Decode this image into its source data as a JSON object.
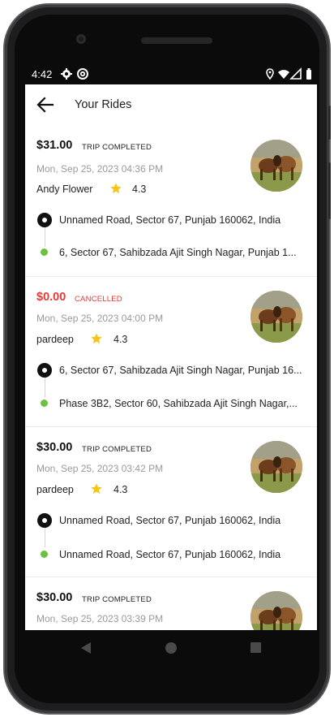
{
  "status_bar": {
    "time": "4:42",
    "left_icons": [
      "gear-icon",
      "at-icon"
    ],
    "right_icons": [
      "location-icon",
      "wifi-icon",
      "signal-icon",
      "battery-icon"
    ]
  },
  "app_bar": {
    "back_icon": "arrow-left-icon",
    "title": "Your Rides"
  },
  "colors": {
    "accent_cancel": "#e53935",
    "drop_dot": "#6ec043",
    "star": "#f5c518"
  },
  "rides": [
    {
      "fare": "$31.00",
      "status": "TRIP COMPLETED",
      "cancelled": false,
      "date": "Mon, Sep 25, 2023 04:36 PM",
      "driver": "Andy Flower",
      "rating": "4.3",
      "pickup": "Unnamed Road, Sector 67, Punjab 160062, India",
      "drop": "6, Sector 67, Sahibzada Ajit Singh Nagar, Punjab 1..."
    },
    {
      "fare": "$0.00",
      "status": "CANCELLED",
      "cancelled": true,
      "date": "Mon, Sep 25, 2023 04:00 PM",
      "driver": "pardeep",
      "rating": "4.3",
      "pickup": "6, Sector 67, Sahibzada Ajit Singh Nagar, Punjab 16...",
      "drop": "Phase 3B2, Sector 60, Sahibzada Ajit Singh Nagar,..."
    },
    {
      "fare": "$30.00",
      "status": "TRIP COMPLETED",
      "cancelled": false,
      "date": "Mon, Sep 25, 2023 03:42 PM",
      "driver": "pardeep",
      "rating": "4.3",
      "pickup": "Unnamed Road, Sector 67, Punjab 160062, India",
      "drop": "Unnamed Road, Sector 67, Punjab 160062, India"
    },
    {
      "fare": "$30.00",
      "status": "TRIP COMPLETED",
      "cancelled": false,
      "date": "Mon, Sep 25, 2023 03:39 PM"
    }
  ],
  "nav_bar": {
    "icons": [
      "nav-back-icon",
      "nav-home-icon",
      "nav-recents-icon"
    ]
  }
}
